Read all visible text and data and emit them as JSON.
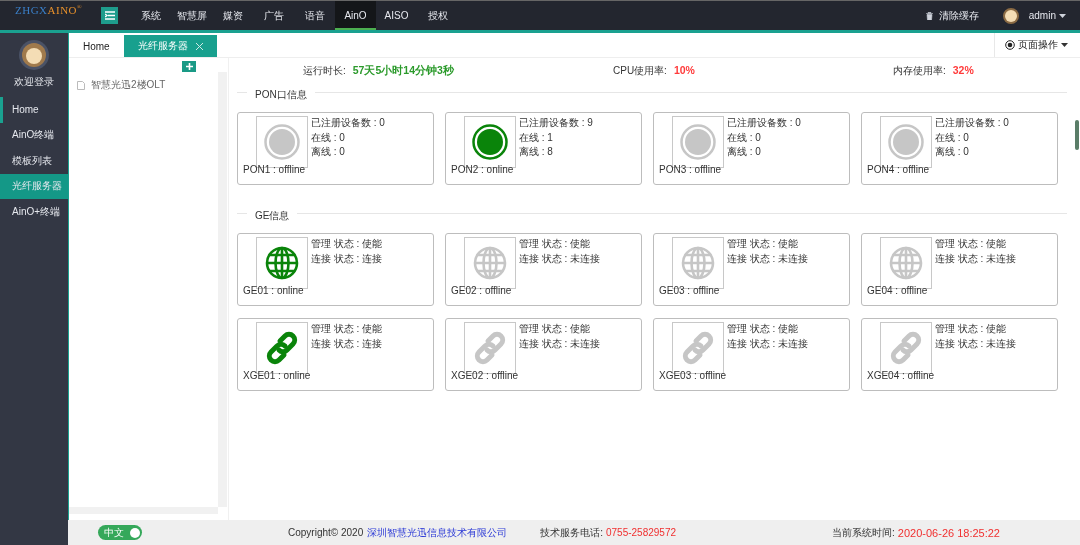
{
  "logo": {
    "part_1": "ZHGX",
    "part_2": "AINO",
    "mark": "®"
  },
  "top_nav": [
    {
      "label": "系统",
      "selected": false
    },
    {
      "label": "智慧屏",
      "selected": false
    },
    {
      "label": "媒资",
      "selected": false
    },
    {
      "label": "广告",
      "selected": false
    },
    {
      "label": "语音",
      "selected": false
    },
    {
      "label": "AinO",
      "selected": true
    },
    {
      "label": "AISO",
      "selected": false
    },
    {
      "label": "授权",
      "selected": false
    }
  ],
  "clear_cache": "清除缓存",
  "user": "admin",
  "sidebar": {
    "greeting": "欢迎登录",
    "items": [
      {
        "label": "Home",
        "selected": false,
        "marker": true
      },
      {
        "label": "AinO终端",
        "selected": false,
        "marker": false
      },
      {
        "label": "模板列表",
        "selected": false,
        "marker": false
      },
      {
        "label": "光纤服务器",
        "selected": true,
        "marker": false
      },
      {
        "label": "AinO+终端",
        "selected": false,
        "marker": false
      }
    ]
  },
  "tabs": [
    {
      "label": "Home",
      "selected": false,
      "closable": false
    },
    {
      "label": "光纤服务器",
      "selected": true,
      "closable": true
    }
  ],
  "page_actions": "页面操作",
  "tree": {
    "items": [
      {
        "label": "智慧光迅2楼OLT"
      }
    ]
  },
  "stats": [
    {
      "label": "运行时长:",
      "value": "57天5小时14分钟3秒",
      "color": "#2b9a2b"
    },
    {
      "label": "CPU使用率:",
      "value": "10%",
      "color": "#ff3b3b"
    },
    {
      "label": "内存使用率:",
      "value": "32%",
      "color": "#ff3b3b"
    }
  ],
  "sections": [
    {
      "title": "PON口信息",
      "cards": [
        {
          "kind": "pon",
          "online": false,
          "lines": [
            "已注册设备数 : 0",
            "在线 : 0",
            "离线 : 0"
          ],
          "caption": "PON1 : offline"
        },
        {
          "kind": "pon",
          "online": true,
          "lines": [
            "已注册设备数 : 9",
            "在线 : 1",
            "离线 : 8"
          ],
          "caption": "PON2 : online"
        },
        {
          "kind": "pon",
          "online": false,
          "lines": [
            "已注册设备数 : 0",
            "在线 : 0",
            "离线 : 0"
          ],
          "caption": "PON3 : offline"
        },
        {
          "kind": "pon",
          "online": false,
          "lines": [
            "已注册设备数 : 0",
            "在线 : 0",
            "离线 : 0"
          ],
          "caption": "PON4 : offline"
        }
      ]
    },
    {
      "title": "GE信息",
      "cards": [
        {
          "kind": "ge",
          "online": true,
          "lines": [
            "管理 状态 : 使能",
            "连接 状态 : 连接"
          ],
          "caption": "GE01 : online"
        },
        {
          "kind": "ge",
          "online": false,
          "lines": [
            "管理 状态 : 使能",
            "连接 状态 : 未连接"
          ],
          "caption": "GE02 : offline"
        },
        {
          "kind": "ge",
          "online": false,
          "lines": [
            "管理 状态 : 使能",
            "连接 状态 : 未连接"
          ],
          "caption": "GE03 : offline"
        },
        {
          "kind": "ge",
          "online": false,
          "lines": [
            "管理 状态 : 使能",
            "连接 状态 : 未连接"
          ],
          "caption": "GE04 : offline"
        },
        {
          "kind": "xge",
          "online": true,
          "lines": [
            "管理 状态 : 使能",
            "连接 状态 : 连接"
          ],
          "caption": "XGE01 : online"
        },
        {
          "kind": "xge",
          "online": false,
          "lines": [
            "管理 状态 : 使能",
            "连接 状态 : 未连接"
          ],
          "caption": "XGE02 : offline"
        },
        {
          "kind": "xge",
          "online": false,
          "lines": [
            "管理 状态 : 使能",
            "连接 状态 : 未连接"
          ],
          "caption": "XGE03 : offline"
        },
        {
          "kind": "xge",
          "online": false,
          "lines": [
            "管理 状态 : 使能",
            "连接 状态 : 未连接"
          ],
          "caption": "XGE04 : offline"
        }
      ]
    }
  ],
  "footer": {
    "language": {
      "label": "中文",
      "on": true
    },
    "copyright": "Copyright© 2020",
    "company": "深圳智慧光迅信息技术有限公司",
    "phone_label": "技术服务电话:",
    "phone": "0755-25829572",
    "time_label": "当前系统时间:",
    "time": "2020-06-26 18:25:22"
  }
}
